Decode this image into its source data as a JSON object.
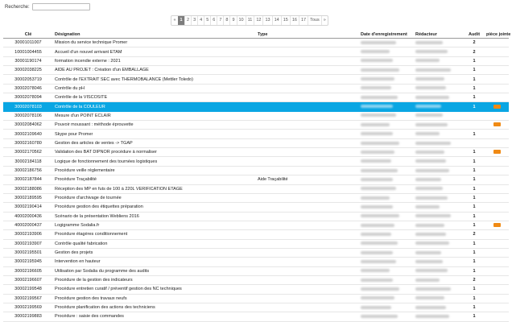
{
  "search": {
    "label": "Recherche:",
    "value": ""
  },
  "pagination": {
    "prev": "«",
    "next": "»",
    "pages": [
      "1",
      "2",
      "3",
      "4",
      "5",
      "6",
      "7",
      "8",
      "9",
      "10",
      "11",
      "12",
      "13",
      "14",
      "15",
      "16",
      "17",
      "Tous"
    ],
    "active": "1"
  },
  "columns": {
    "key": "Clé",
    "designation": "Désignation",
    "type": "Type",
    "date": "Date d'enregistrement",
    "redacteur": "Rédacteur",
    "audit": "Audit",
    "piece": "pièce jointe"
  },
  "rows": [
    {
      "key": "30001011007",
      "designation": "Mission du service technique Promer",
      "type": "",
      "audit": "2",
      "attachment": false
    },
    {
      "key": "10001004455",
      "designation": "Accueil d'un nouvel arrivant ETAM",
      "type": "",
      "audit": "2",
      "attachment": false
    },
    {
      "key": "30001190174",
      "designation": "formation incendie externe : 2021",
      "type": "",
      "audit": "1",
      "attachment": false
    },
    {
      "key": "30002038225",
      "designation": "AIDE AU PROJET : Création d'un EMBALLAGE",
      "type": "",
      "audit": "1",
      "attachment": false
    },
    {
      "key": "30002053719",
      "designation": "Contrôle de l'EXTRAIT SEC avec THERMOBALANCE (Mettler Toledo)",
      "type": "",
      "audit": "1",
      "attachment": false
    },
    {
      "key": "30002078046",
      "designation": "Contrôle du pH",
      "type": "",
      "audit": "1",
      "attachment": false
    },
    {
      "key": "30002078094",
      "designation": "Contrôle de la VISCOSITE",
      "type": "",
      "audit": "1",
      "attachment": false
    },
    {
      "key": "30002078103",
      "designation": "Contrôle de la COULEUR",
      "type": "",
      "audit": "1",
      "attachment": true
    },
    {
      "key": "30002078106",
      "designation": "Mesure d'un POINT ECLAIR",
      "type": "",
      "audit": "",
      "attachment": false
    },
    {
      "key": "30002084062",
      "designation": "Pouvoir moussant : méthode éprouvette",
      "type": "",
      "audit": "",
      "attachment": true
    },
    {
      "key": "30002109640",
      "designation": "Skype pour Promer",
      "type": "",
      "audit": "1",
      "attachment": false
    },
    {
      "key": "30002160780",
      "designation": "Gestion des articles de ventes -> TGAP",
      "type": "",
      "audit": "",
      "attachment": false
    },
    {
      "key": "30002170562",
      "designation": "Validation des BAT DIPNOR procédure à normaliser",
      "type": "",
      "audit": "1",
      "attachment": true
    },
    {
      "key": "30002184118",
      "designation": "Logique de fonctionnement des tournées logistiques",
      "type": "",
      "audit": "1",
      "attachment": false
    },
    {
      "key": "30002186756",
      "designation": "Procédure veille réglementaire",
      "type": "",
      "audit": "1",
      "attachment": false
    },
    {
      "key": "30002187844",
      "designation": "Procédure Traçabilité",
      "type": "Aide Traçabilité",
      "audit": "1",
      "attachment": false
    },
    {
      "key": "30002188086",
      "designation": "Réception des MP en futs de 100 à 220L VERIFICATION ETAGE",
      "type": "",
      "audit": "1",
      "attachment": false
    },
    {
      "key": "30002189595",
      "designation": "Procédure d'archivage de tournée",
      "type": "",
      "audit": "1",
      "attachment": false
    },
    {
      "key": "30002190414",
      "designation": "Procédure gestion des étiquettes préparation",
      "type": "",
      "audit": "1",
      "attachment": false
    },
    {
      "key": "40002000436",
      "designation": "Scénario de la présentation Webliens 2016",
      "type": "",
      "audit": "1",
      "attachment": false
    },
    {
      "key": "40002000437",
      "designation": "Logigramme Sodalia.fr",
      "type": "",
      "audit": "1",
      "attachment": true
    },
    {
      "key": "30002193906",
      "designation": "Procédure étagères conditionnement",
      "type": "",
      "audit": "2",
      "attachment": false
    },
    {
      "key": "30002193907",
      "designation": "Contrôle qualité fabrication",
      "type": "",
      "audit": "1",
      "attachment": false
    },
    {
      "key": "30002195501",
      "designation": "Gestion des projets",
      "type": "",
      "audit": "1",
      "attachment": false
    },
    {
      "key": "30002195945",
      "designation": "Intervention en hauteur",
      "type": "",
      "audit": "1",
      "attachment": false
    },
    {
      "key": "30002196605",
      "designation": "Utilisation par Sodalia du programme des audits",
      "type": "",
      "audit": "1",
      "attachment": false
    },
    {
      "key": "30002196607",
      "designation": "Procédure de la gestion des indicateurs",
      "type": "",
      "audit": "2",
      "attachment": false
    },
    {
      "key": "30002199548",
      "designation": "Procédure entretien curatif / préventif gestion des NC techniques",
      "type": "",
      "audit": "1",
      "attachment": false
    },
    {
      "key": "30002199567",
      "designation": "Procédure gestion des travaux neufs",
      "type": "",
      "audit": "1",
      "attachment": false
    },
    {
      "key": "30002199569",
      "designation": "Procédure planification des actions des techniciens",
      "type": "",
      "audit": "1",
      "attachment": false
    },
    {
      "key": "30002199883",
      "designation": "Procédure : saisie des commandes",
      "type": "",
      "audit": "1",
      "attachment": false
    }
  ],
  "selected_index": 7
}
